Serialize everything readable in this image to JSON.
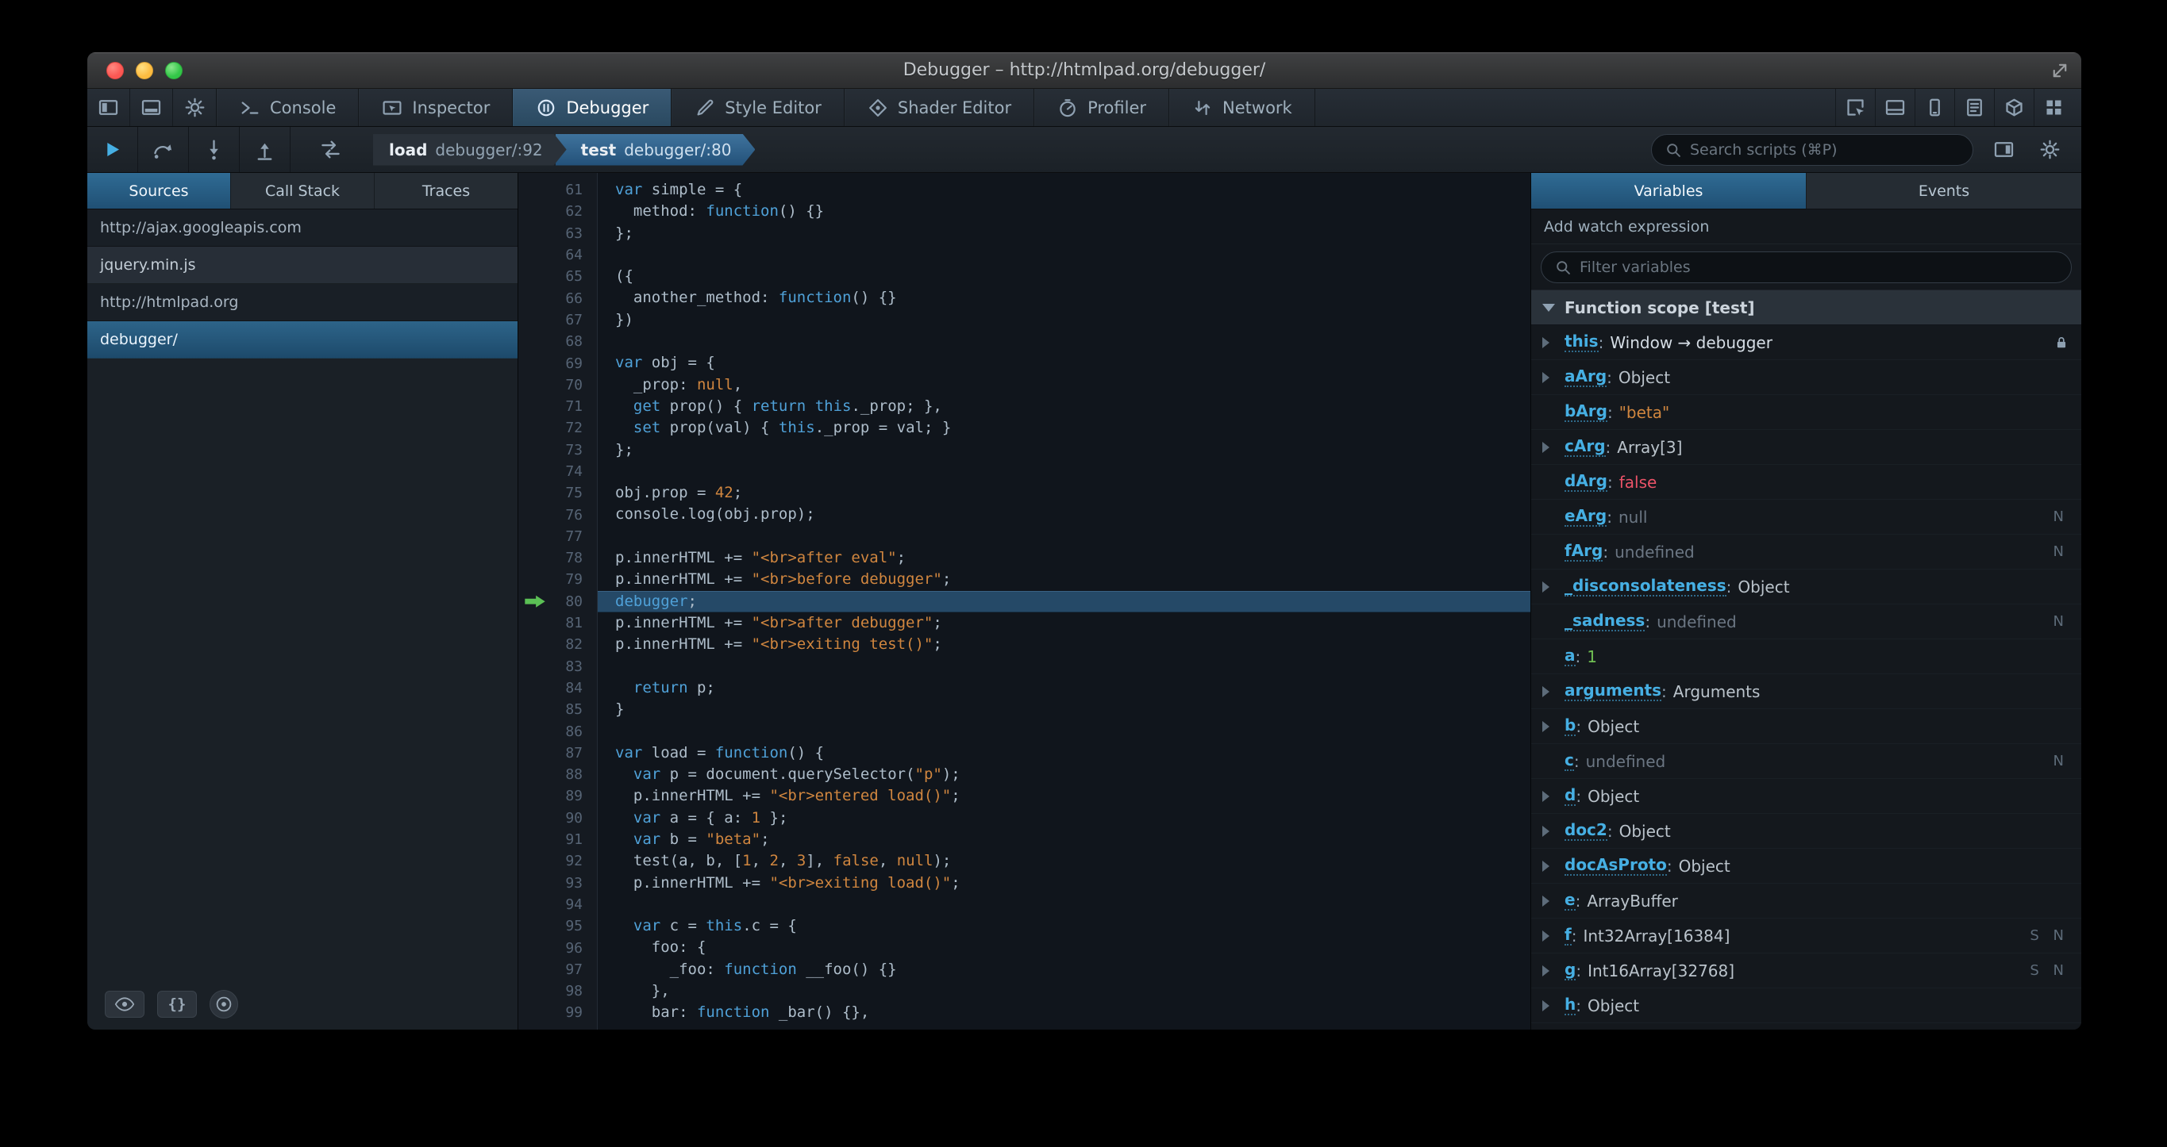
{
  "window": {
    "title": "Debugger – http://htmlpad.org/debugger/"
  },
  "tabbar": {
    "left_icons": [
      "dock-side",
      "dock-bottom",
      "gear"
    ],
    "tabs": [
      {
        "label": "Console",
        "icon": "console"
      },
      {
        "label": "Inspector",
        "icon": "inspector"
      },
      {
        "label": "Debugger",
        "icon": "debugger"
      },
      {
        "label": "Style Editor",
        "icon": "style-editor"
      },
      {
        "label": "Shader Editor",
        "icon": "shader-editor"
      },
      {
        "label": "Profiler",
        "icon": "profiler"
      },
      {
        "label": "Network",
        "icon": "network"
      }
    ],
    "active_tab": "Debugger",
    "right_icons": [
      "pick-element",
      "split-console",
      "responsive-mode",
      "scratchpad",
      "tilt-3d",
      "app-grid"
    ]
  },
  "debugger_toolbar": {
    "frames": [
      {
        "fn": "load",
        "loc": "debugger/:92",
        "selected": false
      },
      {
        "fn": "test",
        "loc": "debugger/:80",
        "selected": true
      }
    ],
    "search_placeholder": "Search scripts (⌘P)"
  },
  "sources": {
    "tabs": [
      "Sources",
      "Call Stack",
      "Traces"
    ],
    "active_tab": "Sources",
    "items": [
      {
        "label": "http://ajax.googleapis.com",
        "type": "group",
        "selected": false
      },
      {
        "label": "jquery.min.js",
        "type": "child",
        "selected": false
      },
      {
        "label": "http://htmlpad.org",
        "type": "group",
        "selected": false
      },
      {
        "label": "debugger/",
        "type": "child",
        "selected": true
      }
    ],
    "braces_label": "{}"
  },
  "editor": {
    "first_line": 61,
    "highlight_line": 80,
    "lines": [
      [
        [
          "k",
          "var"
        ],
        [
          "d",
          " simple = {"
        ]
      ],
      [
        [
          "d",
          "  method: "
        ],
        [
          "k",
          "function"
        ],
        [
          "d",
          "() {}"
        ]
      ],
      [
        [
          "d",
          "};"
        ]
      ],
      [],
      [
        [
          "d",
          "({"
        ]
      ],
      [
        [
          "d",
          "  another_method: "
        ],
        [
          "k",
          "function"
        ],
        [
          "d",
          "() {}"
        ]
      ],
      [
        [
          "d",
          "})"
        ]
      ],
      [],
      [
        [
          "k",
          "var"
        ],
        [
          "d",
          " obj = {"
        ]
      ],
      [
        [
          "d",
          "  _prop: "
        ],
        [
          "a",
          "null"
        ],
        [
          "d",
          ","
        ]
      ],
      [
        [
          "d",
          "  "
        ],
        [
          "k",
          "get"
        ],
        [
          "d",
          " prop() { "
        ],
        [
          "k",
          "return"
        ],
        [
          "d",
          " "
        ],
        [
          "k",
          "this"
        ],
        [
          "d",
          "._prop; },"
        ]
      ],
      [
        [
          "d",
          "  "
        ],
        [
          "k",
          "set"
        ],
        [
          "d",
          " prop(val) { "
        ],
        [
          "k",
          "this"
        ],
        [
          "d",
          "._prop = val; }"
        ]
      ],
      [
        [
          "d",
          "};"
        ]
      ],
      [],
      [
        [
          "d",
          "obj.prop = "
        ],
        [
          "a",
          "42"
        ],
        [
          "d",
          ";"
        ]
      ],
      [
        [
          "d",
          "console.log(obj.prop);"
        ]
      ],
      [],
      [
        [
          "d",
          "p.innerHTML += "
        ],
        [
          "s",
          "\"<br>after eval\""
        ],
        [
          "d",
          ";"
        ]
      ],
      [
        [
          "d",
          "p.innerHTML += "
        ],
        [
          "s",
          "\"<br>before debugger\""
        ],
        [
          "d",
          ";"
        ]
      ],
      [
        [
          "k",
          "debugger"
        ],
        [
          "d",
          ";"
        ]
      ],
      [
        [
          "d",
          "p.innerHTML += "
        ],
        [
          "s",
          "\"<br>after debugger\""
        ],
        [
          "d",
          ";"
        ]
      ],
      [
        [
          "d",
          "p.innerHTML += "
        ],
        [
          "s",
          "\"<br>exiting test()\""
        ],
        [
          "d",
          ";"
        ]
      ],
      [],
      [
        [
          "d",
          "  "
        ],
        [
          "k",
          "return"
        ],
        [
          "d",
          " p;"
        ]
      ],
      [
        [
          "d",
          "}"
        ]
      ],
      [],
      [
        [
          "k",
          "var"
        ],
        [
          "d",
          " load = "
        ],
        [
          "k",
          "function"
        ],
        [
          "d",
          "() {"
        ]
      ],
      [
        [
          "d",
          "  "
        ],
        [
          "k",
          "var"
        ],
        [
          "d",
          " p = document.querySelector("
        ],
        [
          "s",
          "\"p\""
        ],
        [
          "d",
          ");"
        ]
      ],
      [
        [
          "d",
          "  p.innerHTML += "
        ],
        [
          "s",
          "\"<br>entered load()\""
        ],
        [
          "d",
          ";"
        ]
      ],
      [
        [
          "d",
          "  "
        ],
        [
          "k",
          "var"
        ],
        [
          "d",
          " a = { a: "
        ],
        [
          "a",
          "1"
        ],
        [
          "d",
          " };"
        ]
      ],
      [
        [
          "d",
          "  "
        ],
        [
          "k",
          "var"
        ],
        [
          "d",
          " b = "
        ],
        [
          "s",
          "\"beta\""
        ],
        [
          "d",
          ";"
        ]
      ],
      [
        [
          "d",
          "  test(a, b, ["
        ],
        [
          "a",
          "1"
        ],
        [
          "d",
          ", "
        ],
        [
          "a",
          "2"
        ],
        [
          "d",
          ", "
        ],
        [
          "a",
          "3"
        ],
        [
          "d",
          "], "
        ],
        [
          "a",
          "false"
        ],
        [
          "d",
          ", "
        ],
        [
          "a",
          "null"
        ],
        [
          "d",
          ");"
        ]
      ],
      [
        [
          "d",
          "  p.innerHTML += "
        ],
        [
          "s",
          "\"<br>exiting load()\""
        ],
        [
          "d",
          ";"
        ]
      ],
      [],
      [
        [
          "d",
          "  "
        ],
        [
          "k",
          "var"
        ],
        [
          "d",
          " c = "
        ],
        [
          "k",
          "this"
        ],
        [
          "d",
          ".c = {"
        ]
      ],
      [
        [
          "d",
          "    foo: {"
        ]
      ],
      [
        [
          "d",
          "      _foo: "
        ],
        [
          "k",
          "function"
        ],
        [
          "d",
          " __foo() {}"
        ]
      ],
      [
        [
          "d",
          "    },"
        ]
      ],
      [
        [
          "d",
          "    bar: "
        ],
        [
          "k",
          "function"
        ],
        [
          "d",
          " _bar() {},"
        ]
      ]
    ]
  },
  "variables": {
    "tabs": [
      "Variables",
      "Events"
    ],
    "active_tab": "Variables",
    "watch_label": "Add watch expression",
    "filter_placeholder": "Filter variables",
    "scope_label": "Function scope [test]",
    "items": [
      {
        "name": "this",
        "value": "Window → debugger",
        "vclass": "win",
        "arrow": true,
        "lock": true,
        "badge": ""
      },
      {
        "name": "aArg",
        "value": "Object",
        "vclass": "obj",
        "arrow": true,
        "lock": false,
        "badge": ""
      },
      {
        "name": "bArg",
        "value": "\"beta\"",
        "vclass": "str",
        "arrow": false,
        "lock": false,
        "badge": ""
      },
      {
        "name": "cArg",
        "value": "Array[3]",
        "vclass": "obj",
        "arrow": true,
        "lock": false,
        "badge": ""
      },
      {
        "name": "dArg",
        "value": "false",
        "vclass": "bool",
        "arrow": false,
        "lock": false,
        "badge": ""
      },
      {
        "name": "eArg",
        "value": "null",
        "vclass": "undef",
        "arrow": false,
        "lock": false,
        "badge": "N"
      },
      {
        "name": "fArg",
        "value": "undefined",
        "vclass": "undef",
        "arrow": false,
        "lock": false,
        "badge": "N"
      },
      {
        "name": "_disconsolateness",
        "value": "Object",
        "vclass": "obj",
        "arrow": true,
        "lock": false,
        "badge": ""
      },
      {
        "name": "_sadness",
        "value": "undefined",
        "vclass": "undef",
        "arrow": false,
        "lock": false,
        "badge": "N"
      },
      {
        "name": "a",
        "value": "1",
        "vclass": "num",
        "arrow": false,
        "lock": false,
        "badge": ""
      },
      {
        "name": "arguments",
        "value": "Arguments",
        "vclass": "obj",
        "arrow": true,
        "lock": false,
        "badge": ""
      },
      {
        "name": "b",
        "value": "Object",
        "vclass": "obj",
        "arrow": true,
        "lock": false,
        "badge": ""
      },
      {
        "name": "c",
        "value": "undefined",
        "vclass": "undef",
        "arrow": false,
        "lock": false,
        "badge": "N"
      },
      {
        "name": "d",
        "value": "Object",
        "vclass": "obj",
        "arrow": true,
        "lock": false,
        "badge": ""
      },
      {
        "name": "doc2",
        "value": "Object",
        "vclass": "obj",
        "arrow": true,
        "lock": false,
        "badge": ""
      },
      {
        "name": "docAsProto",
        "value": "Object",
        "vclass": "obj",
        "arrow": true,
        "lock": false,
        "badge": ""
      },
      {
        "name": "e",
        "value": "ArrayBuffer",
        "vclass": "obj",
        "arrow": true,
        "lock": false,
        "badge": ""
      },
      {
        "name": "f",
        "value": "Int32Array[16384]",
        "vclass": "obj",
        "arrow": true,
        "lock": false,
        "badge": "S N"
      },
      {
        "name": "g",
        "value": "Int16Array[32768]",
        "vclass": "obj",
        "arrow": true,
        "lock": false,
        "badge": "S N"
      },
      {
        "name": "h",
        "value": "Object",
        "vclass": "obj",
        "arrow": true,
        "lock": false,
        "badge": ""
      }
    ]
  }
}
